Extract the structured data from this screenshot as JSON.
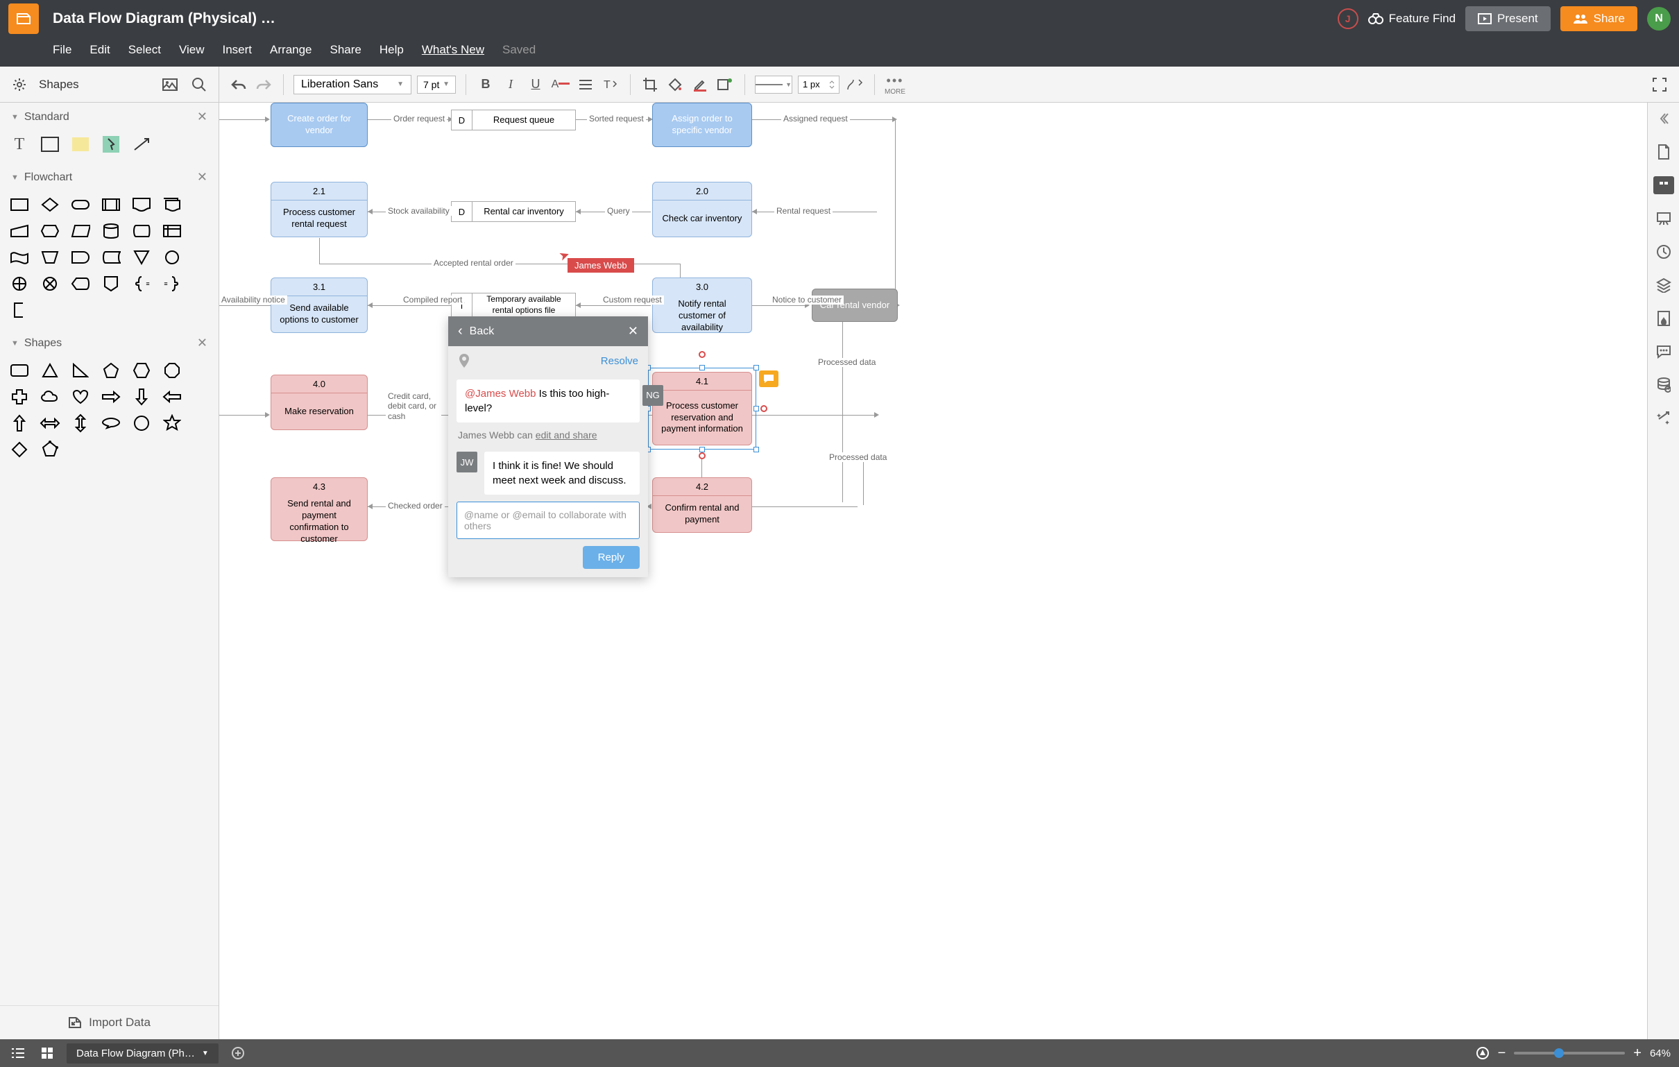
{
  "doc_title": "Data Flow Diagram (Physical) …",
  "menu": [
    "File",
    "Edit",
    "Select",
    "View",
    "Insert",
    "Arrange",
    "Share",
    "Help"
  ],
  "whats_new": "What's New",
  "saved": "Saved",
  "feature_find": "Feature Find",
  "present": "Present",
  "share": "Share",
  "avatar_j": "J",
  "avatar_n": "N",
  "toolbar": {
    "shapes": "Shapes",
    "font": "Liberation Sans",
    "size": "7 pt",
    "line_width": "1 px",
    "more": "MORE"
  },
  "panels": {
    "standard": "Standard",
    "flowchart": "Flowchart",
    "shapes": "Shapes"
  },
  "import_data": "Import Data",
  "nodes": {
    "create_order": "Create order for vendor",
    "request_queue_d": "D",
    "request_queue": "Request queue",
    "assign_order": "Assign order to specific vendor",
    "n21": "2.1",
    "process_request": "Process customer rental request",
    "inv_d": "D",
    "rental_inventory": "Rental car inventory",
    "n20": "2.0",
    "check_inventory": "Check car inventory",
    "n31": "3.1",
    "send_options": "Send available options to customer",
    "temp_t": "T",
    "temp_file": "Temporary available rental options file",
    "n30": "3.0",
    "notify_availability": "Notify rental customer of availability",
    "car_vendor": "Car rental vendor",
    "n40": "4.0",
    "make_reservation": "Make reservation",
    "n41": "4.1",
    "process_payment": "Process customer reservation and payment information",
    "n43": "4.3",
    "send_confirmation": "Send rental and payment confirmation to customer",
    "n42": "4.2",
    "confirm_rental": "Confirm rental and payment"
  },
  "edges": {
    "order_request": "Order request",
    "sorted_request": "Sorted request",
    "assigned_request": "Assigned request",
    "stock_availability": "Stock availability",
    "query": "Query",
    "rental_request": "Rental request",
    "accepted_rental": "Accepted rental order",
    "compiled_report": "Compiled report",
    "custom_request": "Custom request",
    "notice_customer": "Notice to customer",
    "availability_notice": "Availability notice",
    "credit_card": "Credit card, debit card, or cash",
    "checked_order": "Checked order",
    "processed_data_1": "Processed data",
    "processed_data_2": "Processed data"
  },
  "cursor_name": "James Webb",
  "comments": {
    "back": "Back",
    "resolve": "Resolve",
    "mention": "@James Webb",
    "msg1_rest": " Is this too high-level?",
    "avatar1": "NG",
    "share_prefix": "James Webb can ",
    "share_link": "edit and share",
    "avatar2": "JW",
    "msg2": "I think it is fine! We should meet next week and discuss.",
    "placeholder": "@name or @email to collaborate with others",
    "reply": "Reply"
  },
  "footer": {
    "tab": "Data Flow Diagram (Ph…",
    "zoom": "64%"
  }
}
